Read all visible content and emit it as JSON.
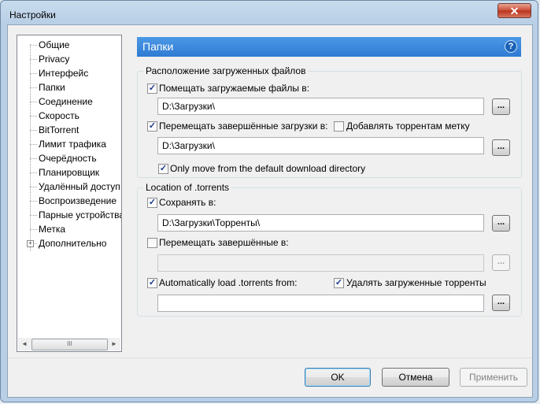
{
  "window": {
    "title": "Настройки"
  },
  "tree": {
    "items": [
      {
        "label": "Общие"
      },
      {
        "label": "Privacy"
      },
      {
        "label": "Интерфейс"
      },
      {
        "label": "Папки"
      },
      {
        "label": "Соединение"
      },
      {
        "label": "Скорость"
      },
      {
        "label": "BitTorrent"
      },
      {
        "label": "Лимит трафика"
      },
      {
        "label": "Очерёдность"
      },
      {
        "label": "Планировщик"
      },
      {
        "label": "Удалённый доступ"
      },
      {
        "label": "Воспроизведение"
      },
      {
        "label": "Парные устройства"
      },
      {
        "label": "Метка"
      },
      {
        "label": "Дополнительно"
      }
    ],
    "selected": "Папки"
  },
  "panel": {
    "title": "Папки",
    "help_icon": "?",
    "downloads_group": {
      "label": "Расположение загруженных файлов",
      "put_new": {
        "label": "Помещать загружаемые файлы в:",
        "checked": true,
        "path": "D:\\Загрузки\\"
      },
      "move_completed": {
        "label": "Перемещать завершённые загрузки в:",
        "checked": true,
        "path": "D:\\Загрузки\\"
      },
      "append_label": {
        "label": "Добавлять торрентам метку",
        "checked": false
      },
      "only_move_default": {
        "label": "Only move from the default download directory",
        "checked": true
      }
    },
    "torrents_group": {
      "label": "Location of .torrents",
      "store": {
        "label": "Сохранять в:",
        "checked": true,
        "path": "D:\\Загрузки\\Торренты\\"
      },
      "move_completed": {
        "label": "Перемещать завершённые в:",
        "checked": false,
        "path": ""
      },
      "autoload": {
        "label": "Automatically load .torrents from:",
        "checked": true,
        "path": ""
      },
      "delete_loaded": {
        "label": "Удалять загруженные торренты",
        "checked": true
      }
    },
    "browse_label": "..."
  },
  "buttons": {
    "ok": "OK",
    "cancel": "Отмена",
    "apply": "Применить"
  },
  "scroll": {
    "thumb_grip": "III",
    "left_arrow": "◄",
    "right_arrow": "►"
  },
  "close_glyph": "✕",
  "checkmark": "✓"
}
